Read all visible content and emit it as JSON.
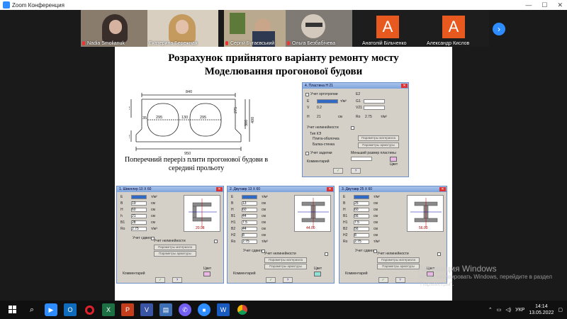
{
  "window": {
    "title": "Zoom Конференция",
    "minimize": "—",
    "maximize": "☐",
    "close": "✕"
  },
  "participants": [
    {
      "name": "Nadia Smolianuk",
      "muted": true,
      "letter": ""
    },
    {
      "name": "Екатерина Бережная",
      "muted": false,
      "letter": ""
    },
    {
      "name": "Сергій Бугаєвський",
      "muted": true,
      "letter": ""
    },
    {
      "name": "Ольга Безбабічева",
      "muted": true,
      "letter": ""
    },
    {
      "name": "Анатолій Більченко",
      "muted": false,
      "letter": "А"
    },
    {
      "name": "Александр Кислов",
      "muted": false,
      "letter": "А"
    }
  ],
  "next_arrow": "›",
  "slide": {
    "title": "Розрахунок прийнятого варіанту ремонту мосту",
    "subtitle": "Моделювання прогонової будови",
    "caption": "Поперечний переріз плити прогонової будови в середині прольоту",
    "drawing": {
      "top": "840",
      "bottom": "950",
      "d1": "295",
      "d2": "130",
      "d3": "295",
      "left": "35",
      "h1": "275",
      "h2": "300",
      "h3": "400",
      "base": "75",
      "side": "75"
    }
  },
  "plate_window": {
    "title": "4. Пластина  H 21",
    "fields": [
      {
        "label": "Учет ортотропии",
        "right": "E2"
      },
      {
        "label": "E",
        "unit": "т/м²",
        "right": "G1"
      },
      {
        "label": "V",
        "value": "0.2",
        "right": "V21"
      },
      {
        "label": "H",
        "value": "21",
        "unit": "см",
        "right": "Ro",
        "rvalue": "2.75",
        "runit": "т/м³"
      }
    ],
    "nonlin": "Учет нелинейности",
    "type_label": "Тип КЭ",
    "opt1": "Плита-оболочка",
    "opt2": "Балка-стенка",
    "b1": "Параметры материала",
    "b2": "Параметры арматуры",
    "depth": "Учет заделки",
    "depth2": "Меньший размер пластины",
    "comment": "Комментарий",
    "color": "Цвет",
    "ok": "✓",
    "help": "?"
  },
  "beam_windows": [
    {
      "title": "1. Швеллер 10 X 60",
      "rows": [
        [
          "E",
          "т/м²"
        ],
        [
          "B",
          "19",
          "см"
        ],
        [
          "H",
          "60",
          "см"
        ],
        [
          "h",
          "21",
          "см"
        ],
        [
          "B1",
          "28",
          "см"
        ],
        [
          "Ro",
          "2.75",
          "т/м³"
        ]
      ],
      "shape": "channel",
      "dim": "20.98",
      "nonlin": "Учет нелинейности",
      "b1": "Параметры материала",
      "b2": "Параметры арматуры",
      "shear": "Учет сдвига",
      "comment": "Комментарий",
      "color": "Цвет",
      "swatch": "#e9b6e6"
    },
    {
      "title": "2. Двутавр 13 X 60",
      "rows": [
        [
          "E",
          "т/м²"
        ],
        [
          "B",
          "13",
          "см"
        ],
        [
          "H",
          "60",
          "см"
        ],
        [
          "B1",
          "44",
          "см"
        ],
        [
          "H1",
          "7.5",
          "см"
        ],
        [
          "B2",
          "44",
          "см"
        ],
        [
          "H2",
          "8",
          "см"
        ],
        [
          "Ro",
          "2.75",
          "т/м³"
        ]
      ],
      "shape": "ibeam",
      "dim": "44.00",
      "nonlin": "Учет нелинейности",
      "b1": "Параметры материала",
      "b2": "Параметры арматуры",
      "shear": "Учет сдвига",
      "comment": "Комментарий",
      "color": "Цвет",
      "swatch": "#8fe1d6"
    },
    {
      "title": "3. Двутавр 25 X 60",
      "rows": [
        [
          "E",
          "т/м²"
        ],
        [
          "B",
          "25",
          "см"
        ],
        [
          "H",
          "60",
          "см"
        ],
        [
          "B1",
          "56",
          "см"
        ],
        [
          "H1",
          "7.5",
          "см"
        ],
        [
          "B2",
          "56",
          "см"
        ],
        [
          "H2",
          "8",
          "см"
        ],
        [
          "Ro",
          "2.75",
          "т/м³"
        ]
      ],
      "shape": "ibeam",
      "dim": "56.00",
      "nonlin": "Учет нелинейности",
      "b1": "Параметры материала",
      "b2": "Параметры арматуры",
      "shear": "Учет сдвига",
      "comment": "Комментарий",
      "color": "Цвет",
      "swatch": "#e9b6e6"
    }
  ],
  "watermark": {
    "line1": "Активация Windows",
    "line2": "Чтобы активировать Windows, перейдите в раздел \"Параметры\"."
  },
  "taskbar": {
    "icons": [
      "windows-icon",
      "search-icon",
      "zoom-meeting-icon",
      "outlook-icon",
      "opera-icon",
      "excel-icon",
      "powerpoint-icon",
      "visio-icon",
      "files-icon",
      "viber-icon",
      "zoom-icon",
      "word-icon",
      "chrome-icon"
    ],
    "lang": "УКР",
    "time": "14:14",
    "date": "13.05.2022"
  }
}
